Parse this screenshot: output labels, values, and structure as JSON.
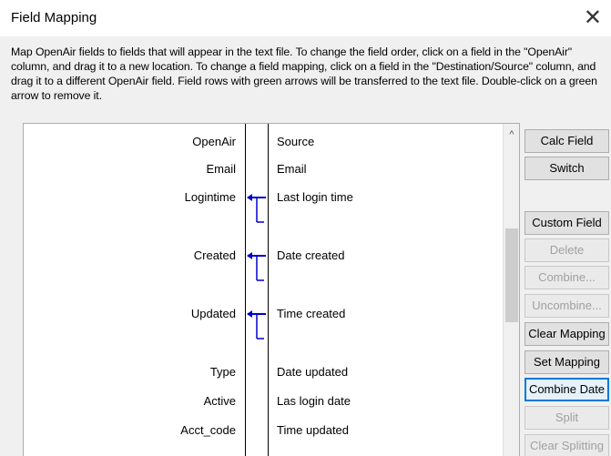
{
  "window": {
    "title": "Field Mapping",
    "close_glyph": "✕"
  },
  "instructions": "Map OpenAir fields to fields that will appear in the text file. To change the field order, click on a field in the \"OpenAir\" column, and drag it to a new location. To change a field mapping, click on a field in the \"Destination/Source\" column, and drag it to a different OpenAir field. Field rows with green arrows will be transferred to the text file. Double-click on a green arrow to remove it.",
  "grid": {
    "header": {
      "openair": "OpenAir",
      "source": "Source"
    },
    "rows": [
      {
        "openair": "Email",
        "source": "Email"
      },
      {
        "openair": "Logintime",
        "source": "Last login time"
      },
      {
        "openair": "Created",
        "source": "Date created"
      },
      {
        "openair": "Updated",
        "source": "Time created"
      },
      {
        "openair": "Type",
        "source": "Date updated"
      },
      {
        "openair": "Active",
        "source": "Las login date"
      },
      {
        "openair": "Acct_code",
        "source": "Time updated"
      }
    ],
    "arrow_color": "#0000cc"
  },
  "scrollbar": {
    "up_glyph": "^"
  },
  "buttons": {
    "calc_field": "Calc Field",
    "switch": "Switch",
    "custom_field": "Custom Field",
    "delete": "Delete",
    "combine": "Combine...",
    "uncombine": "Uncombine...",
    "clear_mapping": "Clear Mapping",
    "set_mapping": "Set Mapping",
    "combine_date": "Combine Date",
    "split": "Split",
    "clear_splitting": "Clear Splitting"
  }
}
